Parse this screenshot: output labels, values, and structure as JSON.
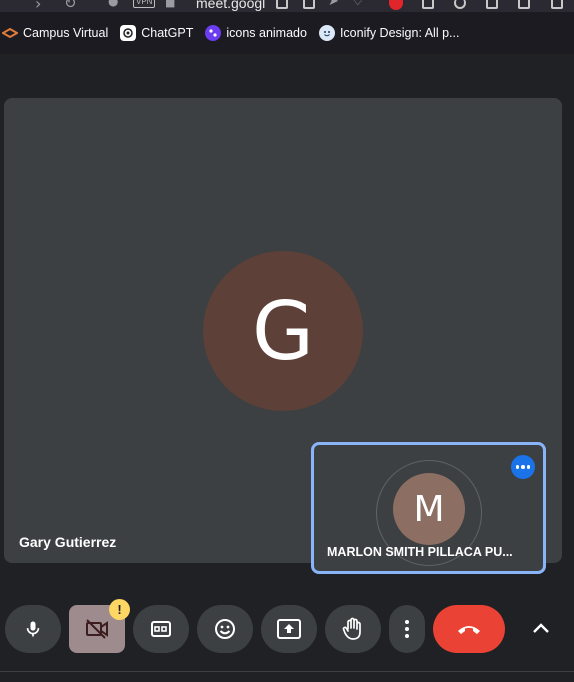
{
  "browser": {
    "url_fragment": "meet.googl",
    "vpn_badge": "VPN"
  },
  "bookmarks": [
    {
      "label": "Campus Virtual",
      "icon": "campus-virtual-icon"
    },
    {
      "label": "ChatGPT",
      "icon": "chatgpt-icon"
    },
    {
      "label": "icons animado",
      "icon": "icons-animado-icon"
    },
    {
      "label": "Iconify Design: All p...",
      "icon": "iconify-icon"
    }
  ],
  "meeting": {
    "main_participant": {
      "initial": "G",
      "name": "Gary Gutierrez",
      "avatar_color": "#5d4037"
    },
    "self_participant": {
      "initial": "M",
      "name": "MARLON SMITH PILLACA PU...",
      "avatar_color": "#8d6e63"
    }
  },
  "controls": {
    "camera_warning": "!",
    "buttons": [
      "microphone",
      "camera-off",
      "captions",
      "emoji-reactions",
      "present-screen",
      "raise-hand",
      "more-options",
      "leave-call",
      "expand"
    ]
  },
  "colors": {
    "stage_background": "#202124",
    "tile_background": "#3c4043",
    "self_tile_border": "#8ab4f8",
    "leave_call": "#ea4335",
    "more_button": "#1a73e8"
  }
}
